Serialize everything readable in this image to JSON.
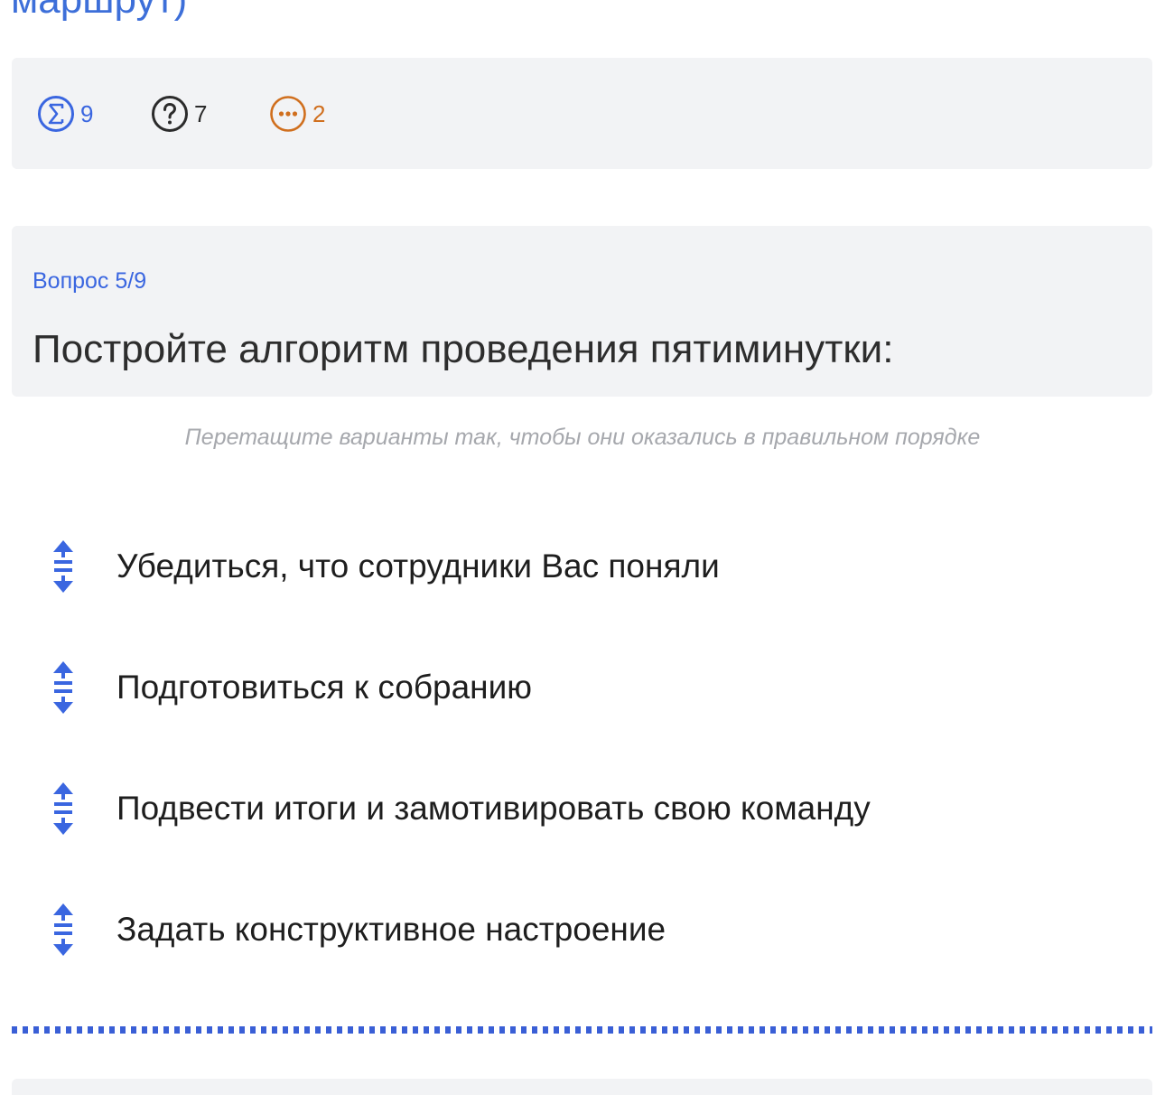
{
  "header": {
    "course_title": "маршрут)"
  },
  "stats": {
    "total": {
      "icon": "sigma-circle-icon",
      "count": "9",
      "color": "#3a66e0"
    },
    "unanswered": {
      "icon": "question-circle-icon",
      "count": "7",
      "color": "#2b2b2b"
    },
    "pending": {
      "icon": "ellipsis-circle-icon",
      "count": "2",
      "color": "#d06f1e"
    }
  },
  "question": {
    "number": "Вопрос 5/9",
    "text": "Постройте алгоритм проведения пятиминутки:"
  },
  "instruction": "Перетащите варианты так, чтобы они оказались в правильном порядке",
  "items": [
    {
      "label": "Убедиться, что сотрудники Вас поняли",
      "icon": "drag-vertical-icon"
    },
    {
      "label": "Подготовиться к собранию",
      "icon": "drag-vertical-icon"
    },
    {
      "label": "Подвести итоги и замотивировать свою команду",
      "icon": "drag-vertical-icon"
    },
    {
      "label": "Задать конструктивное настроение",
      "icon": "drag-vertical-icon"
    }
  ],
  "colors": {
    "accent": "#3a66e0",
    "panel": "#f2f3f5",
    "muted": "#a6a8ad"
  }
}
